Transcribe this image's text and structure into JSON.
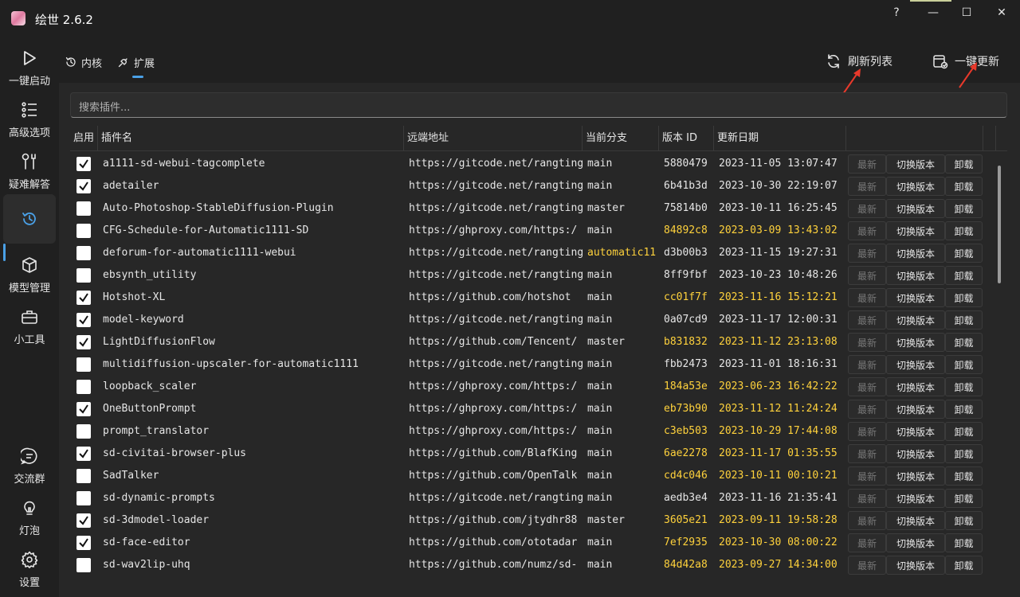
{
  "window": {
    "title": "绘世 2.6.2",
    "help_glyph": "?",
    "minimize_glyph": "—",
    "maximize_glyph": "☐",
    "close_glyph": "✕"
  },
  "sidebar": {
    "items": [
      {
        "label": "一键启动",
        "icon": "play-icon"
      },
      {
        "label": "高级选项",
        "icon": "list-icon"
      },
      {
        "label": "疑难解答",
        "icon": "tools-icon"
      },
      {
        "label": "",
        "icon": "history-icon",
        "active": true
      },
      {
        "label": "模型管理",
        "icon": "cube-icon"
      },
      {
        "label": "小工具",
        "icon": "toolbox-icon"
      },
      {
        "label": "交流群",
        "icon": "chat-icon"
      },
      {
        "label": "灯泡",
        "icon": "bulb-icon"
      },
      {
        "label": "设置",
        "icon": "gear-icon"
      }
    ]
  },
  "tabs": [
    {
      "label": "内核",
      "icon": "history-icon"
    },
    {
      "label": "扩展",
      "icon": "plug-icon",
      "selected": true
    }
  ],
  "actions": {
    "refresh_list": "刷新列表",
    "update_all": "一键更新"
  },
  "search": {
    "placeholder": "搜索插件..."
  },
  "table": {
    "headers": [
      "启用",
      "插件名",
      "远端地址",
      "当前分支",
      "版本 ID",
      "更新日期"
    ],
    "buttons": {
      "latest": "最新",
      "switch": "切换版本",
      "uninstall": "卸载"
    },
    "rows": [
      {
        "enabled": true,
        "name": "a1111-sd-webui-tagcomplete",
        "url": "https://gitcode.net/rangting",
        "branch": "main",
        "version": "5880479",
        "date": "2023-11-05 13:07:47",
        "ver_highlight": false,
        "branch_highlight": false
      },
      {
        "enabled": true,
        "name": "adetailer",
        "url": "https://gitcode.net/rangting",
        "branch": "main",
        "version": "6b41b3d",
        "date": "2023-10-30 22:19:07",
        "ver_highlight": false,
        "branch_highlight": false
      },
      {
        "enabled": false,
        "name": "Auto-Photoshop-StableDiffusion-Plugin",
        "url": "https://gitcode.net/rangting",
        "branch": "master",
        "version": "75814b0",
        "date": "2023-10-11 16:25:45",
        "ver_highlight": false,
        "branch_highlight": false
      },
      {
        "enabled": false,
        "name": "CFG-Schedule-for-Automatic1111-SD",
        "url": "https://ghproxy.com/https:/",
        "branch": "main",
        "version": "84892c8",
        "date": "2023-03-09 13:43:02",
        "ver_highlight": true,
        "branch_highlight": false
      },
      {
        "enabled": false,
        "name": "deforum-for-automatic1111-webui",
        "url": "https://gitcode.net/rangting",
        "branch": "automatic11",
        "version": "d3b00b3",
        "date": "2023-11-15 19:27:31",
        "ver_highlight": false,
        "branch_highlight": true
      },
      {
        "enabled": false,
        "name": "ebsynth_utility",
        "url": "https://gitcode.net/rangting",
        "branch": "main",
        "version": "8ff9fbf",
        "date": "2023-10-23 10:48:26",
        "ver_highlight": false,
        "branch_highlight": false
      },
      {
        "enabled": true,
        "name": "Hotshot-XL",
        "url": "https://github.com/hotshot",
        "branch": "main",
        "version": "cc01f7f",
        "date": "2023-11-16 15:12:21",
        "ver_highlight": true,
        "branch_highlight": false
      },
      {
        "enabled": true,
        "name": "model-keyword",
        "url": "https://gitcode.net/rangting",
        "branch": "main",
        "version": "0a07cd9",
        "date": "2023-11-17 12:00:31",
        "ver_highlight": false,
        "branch_highlight": false
      },
      {
        "enabled": true,
        "name": "LightDiffusionFlow",
        "url": "https://github.com/Tencent/",
        "branch": "master",
        "version": "b831832",
        "date": "2023-11-12 23:13:08",
        "ver_highlight": true,
        "branch_highlight": false
      },
      {
        "enabled": false,
        "name": "multidiffusion-upscaler-for-automatic1111",
        "url": "https://gitcode.net/rangting",
        "branch": "main",
        "version": "fbb2473",
        "date": "2023-11-01 18:16:31",
        "ver_highlight": false,
        "branch_highlight": false
      },
      {
        "enabled": false,
        "name": "loopback_scaler",
        "url": "https://ghproxy.com/https:/",
        "branch": "main",
        "version": "184a53e",
        "date": "2023-06-23 16:42:22",
        "ver_highlight": true,
        "branch_highlight": false
      },
      {
        "enabled": true,
        "name": "OneButtonPrompt",
        "url": "https://ghproxy.com/https:/",
        "branch": "main",
        "version": "eb73b90",
        "date": "2023-11-12 11:24:24",
        "ver_highlight": true,
        "branch_highlight": false
      },
      {
        "enabled": false,
        "name": "prompt_translator",
        "url": "https://ghproxy.com/https:/",
        "branch": "main",
        "version": "c3eb503",
        "date": "2023-10-29 17:44:08",
        "ver_highlight": true,
        "branch_highlight": false
      },
      {
        "enabled": true,
        "name": "sd-civitai-browser-plus",
        "url": "https://github.com/BlafKing",
        "branch": "main",
        "version": "6ae2278",
        "date": "2023-11-17 01:35:55",
        "ver_highlight": true,
        "branch_highlight": false
      },
      {
        "enabled": false,
        "name": "SadTalker",
        "url": "https://github.com/OpenTalk",
        "branch": "main",
        "version": "cd4c046",
        "date": "2023-10-11 00:10:21",
        "ver_highlight": true,
        "branch_highlight": false
      },
      {
        "enabled": false,
        "name": "sd-dynamic-prompts",
        "url": "https://gitcode.net/rangting",
        "branch": "main",
        "version": "aedb3e4",
        "date": "2023-11-16 21:35:41",
        "ver_highlight": false,
        "branch_highlight": false
      },
      {
        "enabled": true,
        "name": "sd-3dmodel-loader",
        "url": "https://github.com/jtydhr88",
        "branch": "master",
        "version": "3605e21",
        "date": "2023-09-11 19:58:28",
        "ver_highlight": true,
        "branch_highlight": false
      },
      {
        "enabled": true,
        "name": "sd-face-editor",
        "url": "https://github.com/ototadar",
        "branch": "main",
        "version": "7ef2935",
        "date": "2023-10-30 08:00:22",
        "ver_highlight": true,
        "branch_highlight": false
      },
      {
        "enabled": false,
        "name": "sd-wav2lip-uhq",
        "url": "https://github.com/numz/sd-",
        "branch": "main",
        "version": "84d42a8",
        "date": "2023-09-27 14:34:00",
        "ver_highlight": true,
        "branch_highlight": false
      }
    ]
  },
  "colors": {
    "accent": "#4aa0e6",
    "highlight_text": "#ffd23c",
    "annotation_arrow": "#e8392b"
  }
}
